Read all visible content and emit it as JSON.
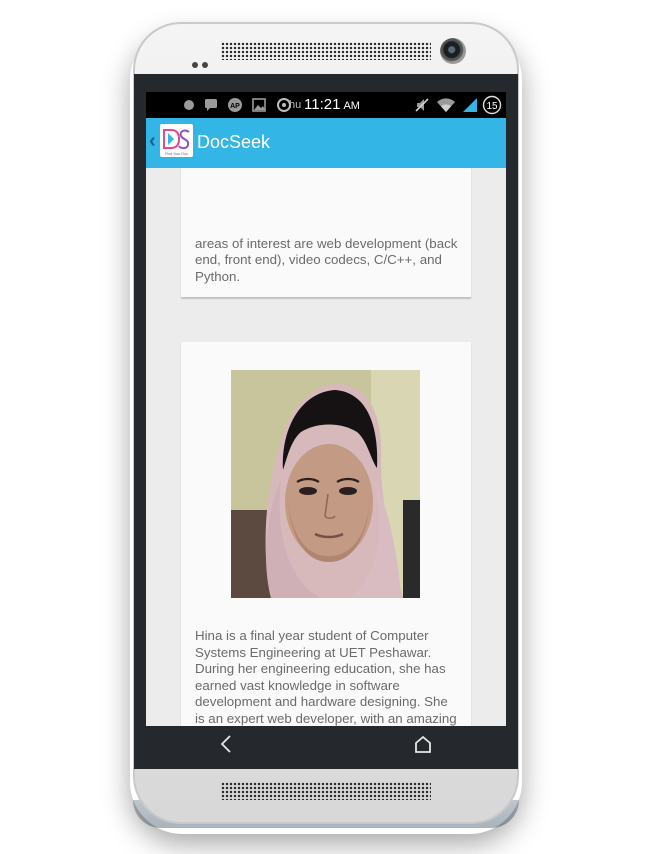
{
  "status_bar": {
    "time": "11:21",
    "ampm": "AM",
    "battery_level": "15",
    "carrier_text": "hu",
    "icons": [
      "record-dot-icon",
      "message-icon",
      "app-store-icon",
      "image-icon",
      "settings-icon",
      "mute-icon",
      "wifi-icon",
      "signal-icon",
      "battery-icon"
    ]
  },
  "app_bar": {
    "title": "DocSeek",
    "logo_text": "DS",
    "logo_tagline": "Find Your Doc"
  },
  "cards": [
    {
      "text": "areas of interest are web development (back\nend, front end), video codecs, C/C++, and\nPython."
    },
    {
      "photo": "profile-photo",
      "text": "Hina is  a final year student of Computer\nSystems Engineering at UET Peshawar.\nDuring her engineering education, she has\nearned vast knowledge in software\ndevelopment and hardware designing. She\nis an expert web developer, with an amazing\nesthetic for design."
    }
  ],
  "colors": {
    "app_bar": "#33b5e5",
    "status_bar": "#000000",
    "screen_background": "#ececec",
    "card_background": "#fafafa",
    "body_text": "#6b6b6b"
  }
}
